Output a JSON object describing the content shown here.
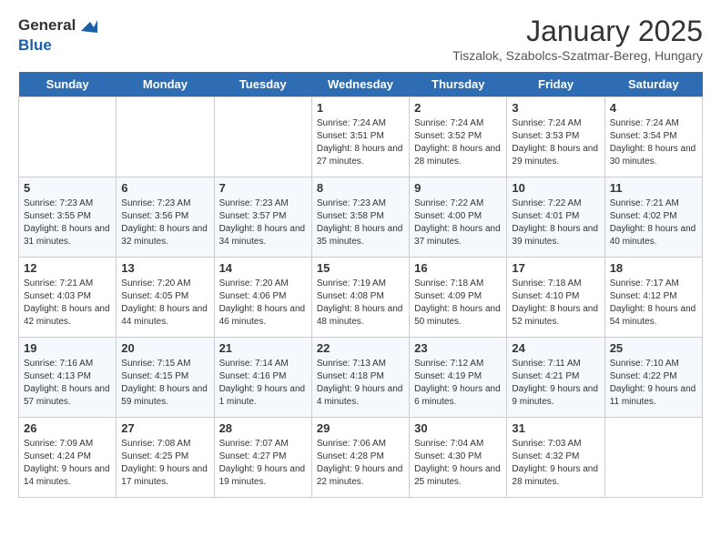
{
  "logo": {
    "general": "General",
    "blue": "Blue"
  },
  "title": "January 2025",
  "subtitle": "Tiszalok, Szabolcs-Szatmar-Bereg, Hungary",
  "headers": [
    "Sunday",
    "Monday",
    "Tuesday",
    "Wednesday",
    "Thursday",
    "Friday",
    "Saturday"
  ],
  "weeks": [
    [
      {
        "num": "",
        "info": ""
      },
      {
        "num": "",
        "info": ""
      },
      {
        "num": "",
        "info": ""
      },
      {
        "num": "1",
        "info": "Sunrise: 7:24 AM\nSunset: 3:51 PM\nDaylight: 8 hours and 27 minutes."
      },
      {
        "num": "2",
        "info": "Sunrise: 7:24 AM\nSunset: 3:52 PM\nDaylight: 8 hours and 28 minutes."
      },
      {
        "num": "3",
        "info": "Sunrise: 7:24 AM\nSunset: 3:53 PM\nDaylight: 8 hours and 29 minutes."
      },
      {
        "num": "4",
        "info": "Sunrise: 7:24 AM\nSunset: 3:54 PM\nDaylight: 8 hours and 30 minutes."
      }
    ],
    [
      {
        "num": "5",
        "info": "Sunrise: 7:23 AM\nSunset: 3:55 PM\nDaylight: 8 hours and 31 minutes."
      },
      {
        "num": "6",
        "info": "Sunrise: 7:23 AM\nSunset: 3:56 PM\nDaylight: 8 hours and 32 minutes."
      },
      {
        "num": "7",
        "info": "Sunrise: 7:23 AM\nSunset: 3:57 PM\nDaylight: 8 hours and 34 minutes."
      },
      {
        "num": "8",
        "info": "Sunrise: 7:23 AM\nSunset: 3:58 PM\nDaylight: 8 hours and 35 minutes."
      },
      {
        "num": "9",
        "info": "Sunrise: 7:22 AM\nSunset: 4:00 PM\nDaylight: 8 hours and 37 minutes."
      },
      {
        "num": "10",
        "info": "Sunrise: 7:22 AM\nSunset: 4:01 PM\nDaylight: 8 hours and 39 minutes."
      },
      {
        "num": "11",
        "info": "Sunrise: 7:21 AM\nSunset: 4:02 PM\nDaylight: 8 hours and 40 minutes."
      }
    ],
    [
      {
        "num": "12",
        "info": "Sunrise: 7:21 AM\nSunset: 4:03 PM\nDaylight: 8 hours and 42 minutes."
      },
      {
        "num": "13",
        "info": "Sunrise: 7:20 AM\nSunset: 4:05 PM\nDaylight: 8 hours and 44 minutes."
      },
      {
        "num": "14",
        "info": "Sunrise: 7:20 AM\nSunset: 4:06 PM\nDaylight: 8 hours and 46 minutes."
      },
      {
        "num": "15",
        "info": "Sunrise: 7:19 AM\nSunset: 4:08 PM\nDaylight: 8 hours and 48 minutes."
      },
      {
        "num": "16",
        "info": "Sunrise: 7:18 AM\nSunset: 4:09 PM\nDaylight: 8 hours and 50 minutes."
      },
      {
        "num": "17",
        "info": "Sunrise: 7:18 AM\nSunset: 4:10 PM\nDaylight: 8 hours and 52 minutes."
      },
      {
        "num": "18",
        "info": "Sunrise: 7:17 AM\nSunset: 4:12 PM\nDaylight: 8 hours and 54 minutes."
      }
    ],
    [
      {
        "num": "19",
        "info": "Sunrise: 7:16 AM\nSunset: 4:13 PM\nDaylight: 8 hours and 57 minutes."
      },
      {
        "num": "20",
        "info": "Sunrise: 7:15 AM\nSunset: 4:15 PM\nDaylight: 8 hours and 59 minutes."
      },
      {
        "num": "21",
        "info": "Sunrise: 7:14 AM\nSunset: 4:16 PM\nDaylight: 9 hours and 1 minute."
      },
      {
        "num": "22",
        "info": "Sunrise: 7:13 AM\nSunset: 4:18 PM\nDaylight: 9 hours and 4 minutes."
      },
      {
        "num": "23",
        "info": "Sunrise: 7:12 AM\nSunset: 4:19 PM\nDaylight: 9 hours and 6 minutes."
      },
      {
        "num": "24",
        "info": "Sunrise: 7:11 AM\nSunset: 4:21 PM\nDaylight: 9 hours and 9 minutes."
      },
      {
        "num": "25",
        "info": "Sunrise: 7:10 AM\nSunset: 4:22 PM\nDaylight: 9 hours and 11 minutes."
      }
    ],
    [
      {
        "num": "26",
        "info": "Sunrise: 7:09 AM\nSunset: 4:24 PM\nDaylight: 9 hours and 14 minutes."
      },
      {
        "num": "27",
        "info": "Sunrise: 7:08 AM\nSunset: 4:25 PM\nDaylight: 9 hours and 17 minutes."
      },
      {
        "num": "28",
        "info": "Sunrise: 7:07 AM\nSunset: 4:27 PM\nDaylight: 9 hours and 19 minutes."
      },
      {
        "num": "29",
        "info": "Sunrise: 7:06 AM\nSunset: 4:28 PM\nDaylight: 9 hours and 22 minutes."
      },
      {
        "num": "30",
        "info": "Sunrise: 7:04 AM\nSunset: 4:30 PM\nDaylight: 9 hours and 25 minutes."
      },
      {
        "num": "31",
        "info": "Sunrise: 7:03 AM\nSunset: 4:32 PM\nDaylight: 9 hours and 28 minutes."
      },
      {
        "num": "",
        "info": ""
      }
    ]
  ]
}
